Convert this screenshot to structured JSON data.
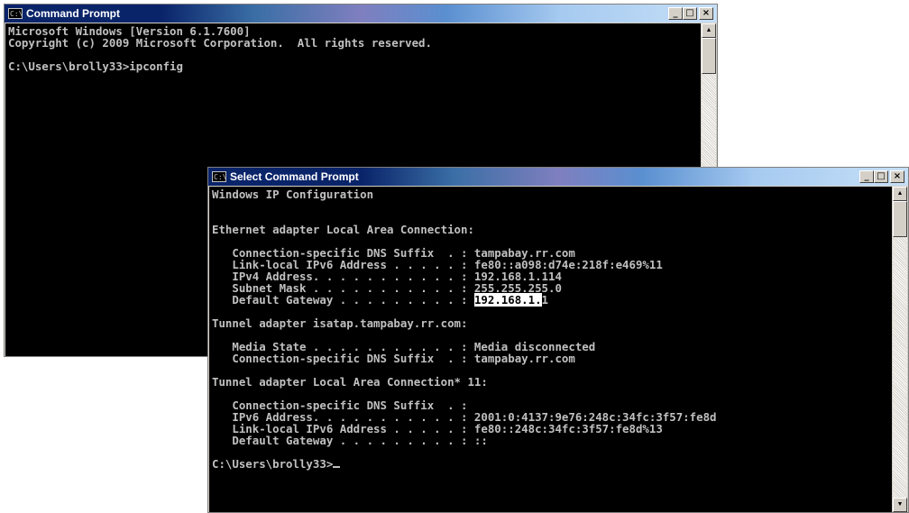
{
  "colors": {
    "console_bg": "#000000",
    "console_text": "#c0c0c0",
    "title_active": "#0a246a"
  },
  "window_back": {
    "title": "Command Prompt",
    "icon_label": "C:\\",
    "lines": [
      "Microsoft Windows [Version 6.1.7600]",
      "Copyright (c) 2009 Microsoft Corporation.  All rights reserved.",
      "",
      "C:\\Users\\brolly33>ipconfig"
    ]
  },
  "window_front": {
    "title": "Select Command Prompt",
    "icon_label": "C:\\",
    "lines_before": [
      "Windows IP Configuration",
      "",
      "",
      "Ethernet adapter Local Area Connection:",
      "",
      "   Connection-specific DNS Suffix  . : tampabay.rr.com",
      "   Link-local IPv6 Address . . . . . : fe80::a098:d74e:218f:e469%11",
      "   IPv4 Address. . . . . . . . . . . : 192.168.1.114",
      "   Subnet Mask . . . . . . . . . . . : 255.255.255.0"
    ],
    "gateway_prefix": "   Default Gateway . . . . . . . . . : ",
    "gateway_selected": "192.168.1.",
    "gateway_rest": "1",
    "lines_after": [
      "",
      "Tunnel adapter isatap.tampabay.rr.com:",
      "",
      "   Media State . . . . . . . . . . . : Media disconnected",
      "   Connection-specific DNS Suffix  . : tampabay.rr.com",
      "",
      "Tunnel adapter Local Area Connection* 11:",
      "",
      "   Connection-specific DNS Suffix  . :",
      "   IPv6 Address. . . . . . . . . . . : 2001:0:4137:9e76:248c:34fc:3f57:fe8d",
      "   Link-local IPv6 Address . . . . . : fe80::248c:34fc:3f57:fe8d%13",
      "   Default Gateway . . . . . . . . . : ::",
      ""
    ],
    "prompt": "C:\\Users\\brolly33>"
  },
  "buttons": {
    "minimize": "_",
    "maximize": "□",
    "close": "×"
  },
  "scroll_arrows": {
    "up": "▲",
    "down": "▼"
  }
}
